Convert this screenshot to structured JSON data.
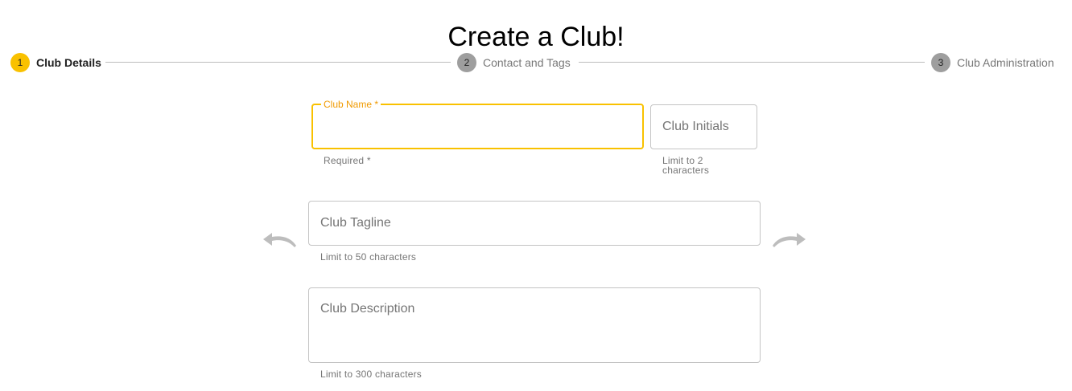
{
  "page": {
    "title": "Create a Club!"
  },
  "stepper": {
    "steps": [
      {
        "number": "1",
        "label": "Club Details",
        "active": true
      },
      {
        "number": "2",
        "label": "Contact and Tags",
        "active": false
      },
      {
        "number": "3",
        "label": "Club Administration",
        "active": false
      }
    ],
    "colors": {
      "active": "#f9c100",
      "inactive": "#9e9e9e"
    }
  },
  "form": {
    "club_name": {
      "legend": "Club Name *",
      "value": "",
      "hint": "Required *"
    },
    "club_initials": {
      "placeholder": "Club Initials",
      "value": "",
      "hint": "Limit to 2 characters"
    },
    "club_tagline": {
      "placeholder": "Club Tagline",
      "value": "",
      "hint": "Limit to 50 characters"
    },
    "club_description": {
      "placeholder": "Club Description",
      "value": "",
      "hint": "Limit to 300 characters"
    }
  },
  "icons": {
    "undo": "undo-icon",
    "redo": "redo-icon"
  },
  "colors": {
    "accent": "#f9c100",
    "label_focus": "#f09a00",
    "border": "#c4c4c4",
    "icon": "#bdbdbd"
  }
}
